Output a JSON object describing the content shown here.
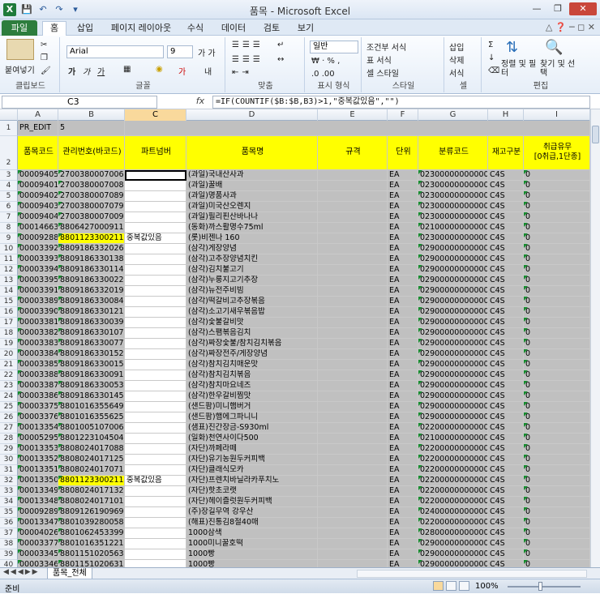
{
  "window": {
    "title": "품목 - Microsoft Excel"
  },
  "tabs": {
    "file": "파일",
    "items": [
      "홈",
      "삽입",
      "페이지 레이아웃",
      "수식",
      "데이터",
      "검토",
      "보기"
    ],
    "active": 0
  },
  "ribbon": {
    "clipboard": {
      "paste": "붙여넣기",
      "label": "클립보드"
    },
    "font": {
      "name": "Arial",
      "size": "9",
      "label": "글꼴"
    },
    "align": {
      "label": "맞춤"
    },
    "number": {
      "format": "일반",
      "label": "표시 형식"
    },
    "style": {
      "cond": "조건부 서식",
      "table": "표 서식",
      "cell": "셀 스타일",
      "label": "스타일"
    },
    "cells": {
      "insert": "삽입",
      "delete": "삭제",
      "format": "서식",
      "label": "셀"
    },
    "edit": {
      "sort": "정렬 및 필터",
      "find": "찾기 및 선택",
      "label": "편집"
    }
  },
  "formula_bar": {
    "cell_ref": "C3",
    "fx": "fx",
    "formula": "=IF(COUNTIF($B:$B,B3)>1,\"중복값있음\",\"\")"
  },
  "columns": [
    "A",
    "B",
    "C",
    "D",
    "E",
    "F",
    "G",
    "H",
    "I"
  ],
  "row1": {
    "a": "PR_EDIT",
    "b": "5"
  },
  "headers": [
    "품목코드",
    "관리번호(바코드)",
    "파트넘버",
    "품목명",
    "규격",
    "단위",
    "분류코드",
    "재고구분",
    "취급유무\n[0취급,1단종]"
  ],
  "rows": [
    {
      "n": "3",
      "code": "00009405",
      "bar": "2700380007006",
      "part": "",
      "name": "(과일)국내산사과",
      "unit": "EA",
      "cls": "023000000000000",
      "stk": "C4S",
      "flag": "0"
    },
    {
      "n": "4",
      "code": "00009401",
      "bar": "2700380007008",
      "part": "",
      "name": "(과일)꿀배",
      "unit": "EA",
      "cls": "023000000000000",
      "stk": "C4S",
      "flag": "0"
    },
    {
      "n": "5",
      "code": "00009402",
      "bar": "2700380007089",
      "part": "",
      "name": "(과일)명품사과",
      "unit": "EA",
      "cls": "023000000000000",
      "stk": "C4S",
      "flag": "0"
    },
    {
      "n": "6",
      "code": "00009403",
      "bar": "2700380007079",
      "part": "",
      "name": "(과일)미국산오렌지",
      "unit": "EA",
      "cls": "023000000000000",
      "stk": "C4S",
      "flag": "0"
    },
    {
      "n": "7",
      "code": "00009404",
      "bar": "2700380007009",
      "part": "",
      "name": "(과일)필리핀산바나나",
      "unit": "EA",
      "cls": "023000000000000",
      "stk": "C4S",
      "flag": "0"
    },
    {
      "n": "8",
      "code": "00014663",
      "bar": "8806427000911",
      "part": "",
      "name": "(동화)까스활명수75ml",
      "unit": "EA",
      "cls": "021000000000000",
      "stk": "C4S",
      "flag": "0"
    },
    {
      "n": "9",
      "code": "00009288",
      "bar": "8801123300211",
      "part": "중복값있음",
      "name": "(롯)비젠나 160",
      "unit": "EA",
      "cls": "023000000000000",
      "stk": "C4S",
      "flag": "0",
      "dup": true
    },
    {
      "n": "10",
      "code": "00003392",
      "bar": "8809186332026",
      "part": "",
      "name": "(삼각)게장양념",
      "unit": "EA",
      "cls": "029000000000000",
      "stk": "C4S",
      "flag": "0"
    },
    {
      "n": "11",
      "code": "00003393",
      "bar": "8809186330138",
      "part": "",
      "name": "(삼각)고추장양념치킨",
      "unit": "EA",
      "cls": "029000000000000",
      "stk": "C4S",
      "flag": "0"
    },
    {
      "n": "12",
      "code": "00003394",
      "bar": "8809186330114",
      "part": "",
      "name": "(삼각)김치불고기",
      "unit": "EA",
      "cls": "029000000000000",
      "stk": "C4S",
      "flag": "0"
    },
    {
      "n": "13",
      "code": "00003395",
      "bar": "8809186330022",
      "part": "",
      "name": "(삼각)누룽지고기추장",
      "unit": "EA",
      "cls": "029000000000000",
      "stk": "C4S",
      "flag": "0"
    },
    {
      "n": "14",
      "code": "00003391",
      "bar": "8809186332019",
      "part": "",
      "name": "(삼각)뉴전주비빔",
      "unit": "EA",
      "cls": "029000000000000",
      "stk": "C4S",
      "flag": "0"
    },
    {
      "n": "15",
      "code": "00003389",
      "bar": "8809186330084",
      "part": "",
      "name": "(삼각)떡갈비고추장볶음",
      "unit": "EA",
      "cls": "029000000000000",
      "stk": "C4S",
      "flag": "0"
    },
    {
      "n": "16",
      "code": "00003390",
      "bar": "8809186330121",
      "part": "",
      "name": "(삼각)소고기새우볶음밥",
      "unit": "EA",
      "cls": "029000000000000",
      "stk": "C4S",
      "flag": "0"
    },
    {
      "n": "17",
      "code": "00003381",
      "bar": "8809186330039",
      "part": "",
      "name": "(삼각)숯불갈비맛",
      "unit": "EA",
      "cls": "029000000000000",
      "stk": "C4S",
      "flag": "0"
    },
    {
      "n": "18",
      "code": "00003382",
      "bar": "8809186330107",
      "part": "",
      "name": "(삼각)스팸볶음김치",
      "unit": "EA",
      "cls": "029000000000000",
      "stk": "C4S",
      "flag": "0"
    },
    {
      "n": "19",
      "code": "00003383",
      "bar": "8809186330077",
      "part": "",
      "name": "(삼각)짜장숯불/참치김치볶음",
      "unit": "EA",
      "cls": "029000000000000",
      "stk": "C4S",
      "flag": "0"
    },
    {
      "n": "20",
      "code": "00003384",
      "bar": "8809186330152",
      "part": "",
      "name": "(삼각)짜장전주/게장양념",
      "unit": "EA",
      "cls": "029000000000000",
      "stk": "C4S",
      "flag": "0"
    },
    {
      "n": "21",
      "code": "00003385",
      "bar": "8809186330015",
      "part": "",
      "name": "(삼각)참치김치매운맛",
      "unit": "EA",
      "cls": "029000000000000",
      "stk": "C4S",
      "flag": "0"
    },
    {
      "n": "22",
      "code": "00003388",
      "bar": "8809186330091",
      "part": "",
      "name": "(삼각)참치김치볶음",
      "unit": "EA",
      "cls": "029000000000000",
      "stk": "C4S",
      "flag": "0"
    },
    {
      "n": "23",
      "code": "00003387",
      "bar": "8809186330053",
      "part": "",
      "name": "(삼각)참치마요네즈",
      "unit": "EA",
      "cls": "029000000000000",
      "stk": "C4S",
      "flag": "0"
    },
    {
      "n": "24",
      "code": "00003386",
      "bar": "8809186330145",
      "part": "",
      "name": "(삼각)한우갈비찜맛",
      "unit": "EA",
      "cls": "029000000000000",
      "stk": "C4S",
      "flag": "0"
    },
    {
      "n": "25",
      "code": "00003375",
      "bar": "8801016355649",
      "part": "",
      "name": "(샌드팜)미니햄버거",
      "unit": "EA",
      "cls": "029000000000000",
      "stk": "C4S",
      "flag": "0"
    },
    {
      "n": "26",
      "code": "00003376",
      "bar": "8801016355625",
      "part": "",
      "name": "(샌드팜)햄에그파니니",
      "unit": "EA",
      "cls": "029000000000000",
      "stk": "C4S",
      "flag": "0"
    },
    {
      "n": "27",
      "code": "00013354",
      "bar": "8801005107006",
      "part": "",
      "name": "(샘표)진간장금-S930ml",
      "unit": "EA",
      "cls": "022000000000000",
      "stk": "C4S",
      "flag": "0"
    },
    {
      "n": "28",
      "code": "00005295",
      "bar": "8801223104504",
      "part": "",
      "name": "(일화)천연사이다500",
      "unit": "EA",
      "cls": "021000000000000",
      "stk": "C4S",
      "flag": "0"
    },
    {
      "n": "29",
      "code": "00013353",
      "bar": "8808024017088",
      "part": "",
      "name": "(자단)까페라떼",
      "unit": "EA",
      "cls": "022000000000000",
      "stk": "C4S",
      "flag": "0"
    },
    {
      "n": "30",
      "code": "00013352",
      "bar": "8808024017125",
      "part": "",
      "name": "(자단)유기농원두커피백",
      "unit": "EA",
      "cls": "022000000000000",
      "stk": "C4S",
      "flag": "0"
    },
    {
      "n": "31",
      "code": "00013351",
      "bar": "8808024017071",
      "part": "",
      "name": "(자단)클래식모카",
      "unit": "EA",
      "cls": "022000000000000",
      "stk": "C4S",
      "flag": "0"
    },
    {
      "n": "32",
      "code": "00013350",
      "bar": "8801123300211",
      "part": "중복값있음",
      "name": "(자단)프렌치바닐라카푸치노",
      "unit": "EA",
      "cls": "022000000000000",
      "stk": "C4S",
      "flag": "0",
      "dup": true
    },
    {
      "n": "33",
      "code": "00013349",
      "bar": "8808024017132",
      "part": "",
      "name": "(자단)핫초코랫",
      "unit": "EA",
      "cls": "022000000000000",
      "stk": "C4S",
      "flag": "0"
    },
    {
      "n": "34",
      "code": "00013348",
      "bar": "8808024017101",
      "part": "",
      "name": "(자단)헤이즐럿원두커피백",
      "unit": "EA",
      "cls": "022000000000000",
      "stk": "C4S",
      "flag": "0"
    },
    {
      "n": "35",
      "code": "00009289",
      "bar": "8809126190969",
      "part": "",
      "name": "(주)장길무역 강우산",
      "unit": "EA",
      "cls": "024000000000000",
      "stk": "C4S",
      "flag": "0"
    },
    {
      "n": "36",
      "code": "00013347",
      "bar": "8801039280058",
      "part": "",
      "name": "(해표)진통김8절40매",
      "unit": "EA",
      "cls": "022000000000000",
      "stk": "C4S",
      "flag": "0"
    },
    {
      "n": "37",
      "code": "00004026",
      "bar": "8801062453399",
      "part": "",
      "name": "1000삼색",
      "unit": "EA",
      "cls": "028000000000000",
      "stk": "C4S",
      "flag": "0"
    },
    {
      "n": "38",
      "code": "00003377",
      "bar": "8801016351221",
      "part": "",
      "name": "1000미니꿀호떡",
      "unit": "EA",
      "cls": "029000000000000",
      "stk": "C4S",
      "flag": "0"
    },
    {
      "n": "39",
      "code": "00003345",
      "bar": "8801151020563",
      "part": "",
      "name": "1000빵",
      "unit": "EA",
      "cls": "029000000000000",
      "stk": "C4S",
      "flag": "0"
    },
    {
      "n": "40",
      "code": "00003346",
      "bar": "8801151020631",
      "part": "",
      "name": "1000빵",
      "unit": "EA",
      "cls": "029000000000000",
      "stk": "C4S",
      "flag": "0"
    }
  ],
  "sheet_tab": "품목_전체",
  "status": {
    "ready": "준비",
    "zoom": "100%"
  }
}
